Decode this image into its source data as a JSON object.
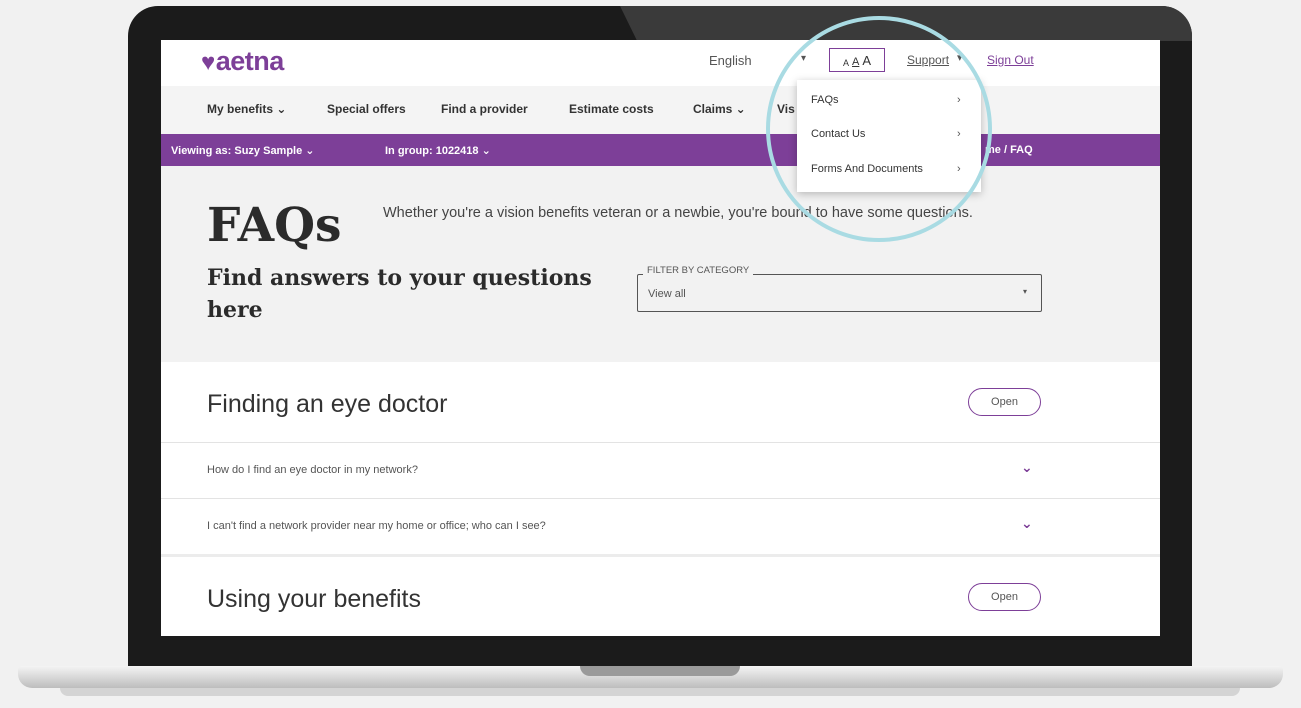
{
  "header": {
    "logo_text": "aetna",
    "logo_heart": "♥",
    "language": "English",
    "text_size": [
      "A",
      "A",
      "A"
    ],
    "support": "Support",
    "sign_out": "Sign Out"
  },
  "nav": {
    "items": [
      "My benefits ⌄",
      "Special offers",
      "Find a provider",
      "Estimate costs",
      "Claims ⌄",
      "Vis"
    ]
  },
  "view_bar": {
    "viewing_as": "Viewing as: Suzy Sample ⌄",
    "in_group": "In group: 1022418 ⌄",
    "breadcrumb": "me / FAQ"
  },
  "support_menu": {
    "items": [
      {
        "label": "FAQs",
        "arrow": "›"
      },
      {
        "label": "Contact Us",
        "arrow": "›"
      },
      {
        "label": "Forms And Documents",
        "arrow": "›"
      }
    ]
  },
  "faq_header": {
    "title": "FAQs",
    "intro": "Whether you're a vision benefits veteran or a newbie, you're bound to have some questions.",
    "find_title": "Find answers to your questions here",
    "filter_label": "FILTER BY CATEGORY",
    "filter_value": "View all"
  },
  "sections": [
    {
      "title": "Finding an eye doctor",
      "button": "Open",
      "questions": [
        "How do I find an eye doctor in my network?",
        "I can't find a network provider near my home or office; who can I see?"
      ]
    },
    {
      "title": "Using your benefits",
      "button": "Open",
      "questions": []
    }
  ],
  "colors": {
    "brand_purple": "#7d3f98",
    "highlight_ring": "#a9dbe3"
  }
}
